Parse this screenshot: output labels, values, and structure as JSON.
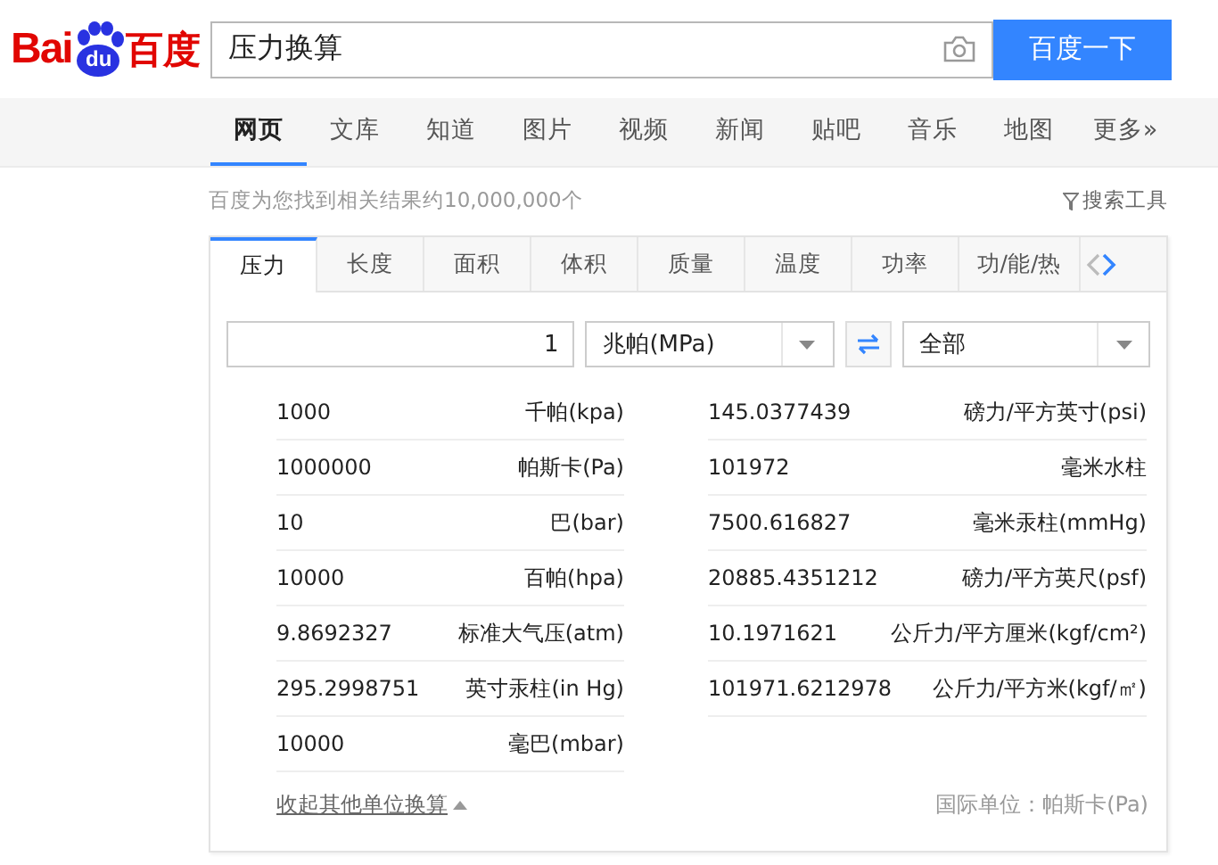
{
  "logo": {
    "left": "Bai",
    "paw": "du",
    "right": "百度"
  },
  "search": {
    "value": "压力换算",
    "button": "百度一下"
  },
  "nav": [
    {
      "label": "网页",
      "selected": true
    },
    {
      "label": "文库",
      "selected": false
    },
    {
      "label": "知道",
      "selected": false
    },
    {
      "label": "图片",
      "selected": false
    },
    {
      "label": "视频",
      "selected": false
    },
    {
      "label": "新闻",
      "selected": false
    },
    {
      "label": "贴吧",
      "selected": false
    },
    {
      "label": "音乐",
      "selected": false
    },
    {
      "label": "地图",
      "selected": false
    },
    {
      "label": "更多»",
      "selected": false
    }
  ],
  "result_count": "百度为您找到相关结果约10,000,000个",
  "search_tools": "搜索工具",
  "converter": {
    "tabs": [
      {
        "label": "压力",
        "selected": true
      },
      {
        "label": "长度",
        "selected": false
      },
      {
        "label": "面积",
        "selected": false
      },
      {
        "label": "体积",
        "selected": false
      },
      {
        "label": "质量",
        "selected": false
      },
      {
        "label": "温度",
        "selected": false
      },
      {
        "label": "功率",
        "selected": false
      },
      {
        "label": "功/能/热",
        "selected": false
      }
    ],
    "amount": "1",
    "unit": "兆帕(MPa)",
    "target": "全部",
    "left": [
      {
        "value": "1000",
        "unit": "千帕(kpa)"
      },
      {
        "value": "1000000",
        "unit": "帕斯卡(Pa)"
      },
      {
        "value": "10",
        "unit": "巴(bar)"
      },
      {
        "value": "10000",
        "unit": "百帕(hpa)"
      },
      {
        "value": "9.8692327",
        "unit": "标准大气压(atm)"
      },
      {
        "value": "295.2998751",
        "unit": "英寸汞柱(in Hg)"
      },
      {
        "value": "10000",
        "unit": "毫巴(mbar)"
      }
    ],
    "right": [
      {
        "value": "145.0377439",
        "unit": "磅力/平方英寸(psi)"
      },
      {
        "value": "101972",
        "unit": "毫米水柱"
      },
      {
        "value": "7500.616827",
        "unit": "毫米汞柱(mmHg)"
      },
      {
        "value": "20885.4351212",
        "unit": "磅力/平方英尺(psf)"
      },
      {
        "value": "10.1971621",
        "unit": "公斤力/平方厘米(kgf/cm²)"
      },
      {
        "value": "101971.6212978",
        "unit": "公斤力/平方米(kgf/㎡)"
      }
    ],
    "collapse_link": "收起其他单位换算",
    "si_unit": "国际单位：帕斯卡(Pa)"
  }
}
